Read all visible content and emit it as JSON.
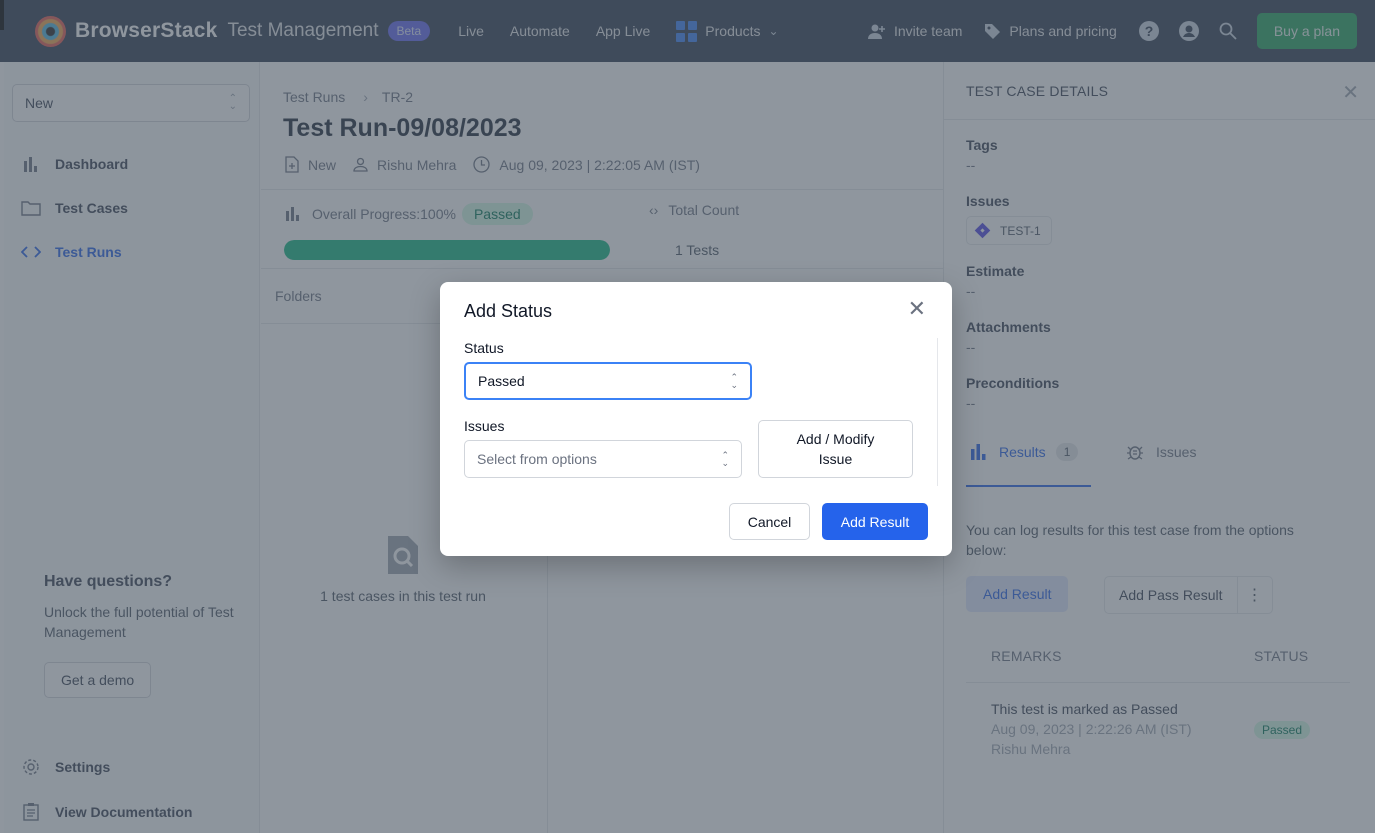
{
  "topnav": {
    "brand_name": "BrowserStack",
    "brand_sub": "Test Management",
    "beta_badge": "Beta",
    "links": [
      "Live",
      "Automate",
      "App Live"
    ],
    "products_label": "Products",
    "invite_label": "Invite team",
    "pricing_label": "Plans and pricing",
    "buy_label": "Buy a plan"
  },
  "sidebar": {
    "project_select_value": "New",
    "items": [
      {
        "label": "Dashboard",
        "icon": "bar-chart-icon"
      },
      {
        "label": "Test Cases",
        "icon": "folder-icon"
      },
      {
        "label": "Test Runs",
        "icon": "code-brackets-icon",
        "active": true
      }
    ],
    "help": {
      "title": "Have questions?",
      "text": "Unlock the full potential of Test Management",
      "button": "Get a demo"
    },
    "footer_items": [
      {
        "label": "Settings",
        "icon": "gear-icon"
      },
      {
        "label": "View Documentation",
        "icon": "clipboard-icon"
      }
    ]
  },
  "main": {
    "breadcrumb": [
      "Test Runs",
      "TR-2"
    ],
    "title": "Test Run-09/08/2023",
    "meta": {
      "state": "New",
      "owner": "Rishu Mehra",
      "created": "Aug 09, 2023 | 2:22:05 AM (IST)"
    },
    "progress": {
      "label": "Overall Progress:100%",
      "percent": 100,
      "status": "Passed"
    },
    "total": {
      "label": "Total Count",
      "value": "1 Tests"
    },
    "folders_label": "Folders",
    "empty_text": "1 test cases in this test run"
  },
  "details": {
    "heading": "TEST CASE DETAILS",
    "fields": [
      {
        "label": "Tags",
        "value": "--"
      },
      {
        "label": "Issues",
        "value": "TEST-1"
      },
      {
        "label": "Estimate",
        "value": "--"
      },
      {
        "label": "Attachments",
        "value": "--"
      },
      {
        "label": "Preconditions",
        "value": "--"
      }
    ],
    "tabs": {
      "results_label": "Results",
      "results_count": "1",
      "issues_label": "Issues"
    },
    "hint": "You can log results for this test case from the options below:",
    "add_result_label": "Add Result",
    "add_pass_label": "Add Pass Result",
    "table": {
      "headers": [
        "REMARKS",
        "STATUS"
      ],
      "rows": [
        {
          "title": "This test is marked as Passed",
          "date": "Aug 09, 2023 | 2:22:26 AM (IST)",
          "user": "Rishu Mehra",
          "status": "Passed"
        }
      ]
    }
  },
  "modal": {
    "title": "Add Status",
    "status_label": "Status",
    "status_value": "Passed",
    "issues_label": "Issues",
    "issues_placeholder": "Select from options",
    "modify_issue_label": "Add / Modify Issue",
    "cancel_label": "Cancel",
    "submit_label": "Add Result"
  },
  "colors": {
    "accent": "#2563eb",
    "success": "#10b981",
    "nav_bg": "#2f3a4f",
    "buy_button": "#22a45d"
  }
}
